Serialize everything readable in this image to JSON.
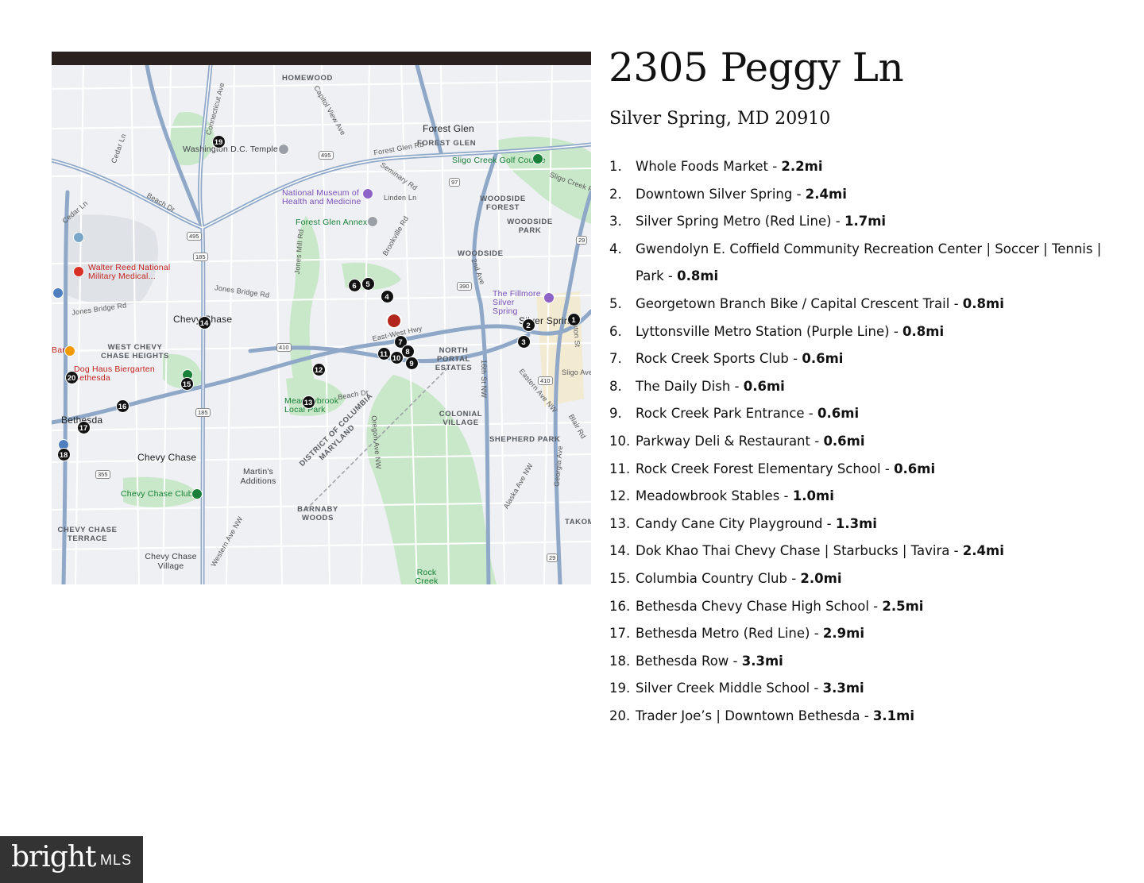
{
  "property": {
    "address": "2305 Peggy Ln",
    "city_state_zip": "Silver Spring, MD 20910"
  },
  "places": [
    {
      "num": "1.",
      "name": "Whole Foods Market - ",
      "dist": "2.2mi"
    },
    {
      "num": "2.",
      "name": "Downtown Silver Spring - ",
      "dist": "2.4mi"
    },
    {
      "num": "3.",
      "name": "Silver Spring Metro (Red Line) - ",
      "dist": "1.7mi"
    },
    {
      "num": "4.",
      "name": "Gwendolyn E. Coffield Community Recreation Center | Soccer | Tennis | Park - ",
      "dist": "0.8mi"
    },
    {
      "num": "5.",
      "name": "Georgetown Branch Bike / Capital Crescent Trail - ",
      "dist": "0.8mi"
    },
    {
      "num": "6.",
      "name": "Lyttonsville Metro Station (Purple Line) - ",
      "dist": "0.8mi"
    },
    {
      "num": "7.",
      "name": "Rock Creek Sports Club - ",
      "dist": "0.6mi"
    },
    {
      "num": "8.",
      "name": "The Daily Dish - ",
      "dist": "0.6mi"
    },
    {
      "num": "9.",
      "name": "Rock Creek Park Entrance - ",
      "dist": "0.6mi"
    },
    {
      "num": "10.",
      "name": "Parkway Deli & Restaurant - ",
      "dist": "0.6mi"
    },
    {
      "num": "11.",
      "name": "Rock Creek Forest Elementary School - ",
      "dist": "0.6mi"
    },
    {
      "num": "12.",
      "name": "Meadowbrook Stables - ",
      "dist": "1.0mi"
    },
    {
      "num": "13.",
      "name": "Candy Cane City Playground - ",
      "dist": "1.3mi"
    },
    {
      "num": "14.",
      "name": "Dok Khao Thai Chevy Chase | Starbucks | Tavira - ",
      "dist": "2.4mi"
    },
    {
      "num": "15.",
      "name": "Columbia Country Club - ",
      "dist": "2.0mi"
    },
    {
      "num": "16.",
      "name": "Bethesda Chevy Chase High School - ",
      "dist": "2.5mi"
    },
    {
      "num": "17.",
      "name": "Bethesda Metro (Red Line) - ",
      "dist": "2.9mi"
    },
    {
      "num": "18.",
      "name": "Bethesda Row - ",
      "dist": "3.3mi"
    },
    {
      "num": "19.",
      "name": "Silver Creek Middle School - ",
      "dist": "3.3mi"
    },
    {
      "num": "20.",
      "name": "Trader Joe’s | Downtown Bethesda - ",
      "dist": "3.1mi"
    }
  ],
  "map": {
    "area_labels": {
      "homewood": "HOMEWOOD",
      "forest_glen": "Forest Glen",
      "forest_glen_caps": "FOREST GLEN",
      "woodside_forest": "WOODSIDE FOREST",
      "woodside_park": "WOODSIDE PARK",
      "woodside": "WOODSIDE",
      "silver_spring": "Silver Sprin",
      "chevy_chase_top": "Chevy Chase",
      "west_chevy_chase_heights": "WEST CHEVY CHASE HEIGHTS",
      "north_portal_estates": "NORTH PORTAL ESTATES",
      "colonial_village": "COLONIAL VILLAGE",
      "shepherd_park": "SHEPHERD PARK",
      "bethesda": "Bethesda",
      "chevy_chase": "Chevy Chase",
      "martins_additions": "Martin's Additions",
      "barnaby_woods": "BARNABY WOODS",
      "chevy_chase_terrace": "CHEVY CHASE TERRACE",
      "chevy_chase_village": "Chevy Chase Village",
      "takoma": "TAKOM",
      "maryland": "MARYLAND",
      "district_of_columbia": "DISTRICT OF COLUMBIA"
    },
    "poi_labels": {
      "temple": "Washington D.C. Temple",
      "sligo_golf": "Sligo Creek Golf Course",
      "museum": "National Museum of Health and Medicine",
      "forest_glen_annex": "Forest Glen Annex",
      "walter_reed": "Walter Reed National Military Medical...",
      "fillmore": "The Fillmore Silver Spring",
      "dog_haus": "Dog Haus Biergarten Bethesda",
      "meadowbrook": "Meadowbrook Local Park",
      "chevy_chase_club": "Chevy Chase Club",
      "rock_creek_park": "Rock Creek Park",
      "bar": "Bar"
    },
    "road_labels": {
      "connecticut": "Connecticut Ave",
      "capitol_view": "Capitol View Ave",
      "forest_glen_rd": "Forest Glen Rd",
      "seminary": "Seminary Rd",
      "linden": "Linden Ln",
      "brookville": "Brookville Rd",
      "jones_mill": "Jones Mill Rd",
      "jones_bridge": "Jones Bridge Rd",
      "east_west_hwy": "East-West Hwy",
      "beach_dr": "Beach Dr",
      "sixteenth": "16th St NW",
      "georgia": "Georgia Ave",
      "second_ave": "2nd Ave",
      "eastern": "Eastern Ave NW",
      "oregon": "Oregon Ave NW",
      "western": "Western Ave NW",
      "sligo_pkwy": "Sligo Creek Pkwy",
      "cedar": "Cedar Ln",
      "alaska": "Alaska Ave NW",
      "fenton": "Fenton St",
      "sligo_ave": "Sligo Ave",
      "blair": "Blair Rd"
    },
    "shields": {
      "i495": "495",
      "i495b": "495",
      "r97": "97",
      "r29": "29",
      "r29b": "29",
      "r185": "185",
      "r185b": "185",
      "r410": "410",
      "r410b": "410",
      "r390": "390",
      "r355": "355"
    },
    "markers": [
      "1",
      "2",
      "3",
      "4",
      "5",
      "6",
      "7",
      "8",
      "9",
      "10",
      "11",
      "12",
      "13",
      "14",
      "15",
      "16",
      "17",
      "18",
      "19",
      "20"
    ]
  },
  "branding": {
    "brand": "bright",
    "mls": "MLS"
  },
  "colors": {
    "map_bar": "#2b2220",
    "park_green": "#c8e6c9",
    "road_blue": "#8fa8c8",
    "home_marker": "#b3261e",
    "logo_bg": "#333333"
  }
}
